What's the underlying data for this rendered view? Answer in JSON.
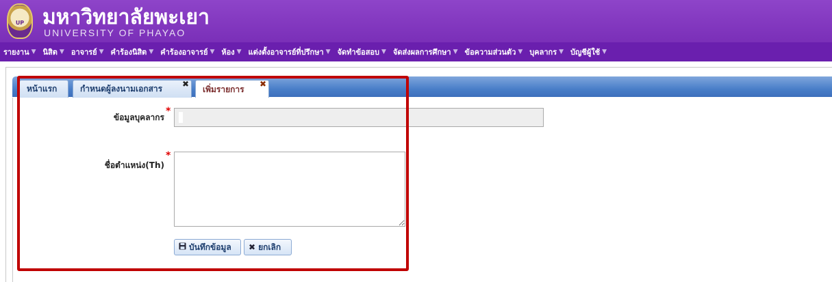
{
  "header": {
    "brand_th": "มหาวิทยาลัยพะเยา",
    "brand_en": "UNIVERSITY OF PHAYAO",
    "logo_text": "UP",
    "colors": {
      "header_bg": "#8e44c9",
      "nav_bg": "#6a1fae"
    }
  },
  "nav": {
    "items": [
      {
        "label": "รายงาน"
      },
      {
        "label": "นิสิต"
      },
      {
        "label": "อาจารย์"
      },
      {
        "label": "คำร้องนิสิต"
      },
      {
        "label": "คำร้องอาจารย์"
      },
      {
        "label": "ห้อง"
      },
      {
        "label": "แต่งตั้งอาจารย์ที่ปรึกษา"
      },
      {
        "label": "จัดทำข้อสอบ"
      },
      {
        "label": "จัดส่งผลการศึกษา"
      },
      {
        "label": "ข้อความส่วนตัว"
      },
      {
        "label": "บุคลากร"
      },
      {
        "label": "บัญชีผู้ใช้"
      }
    ],
    "caret": "▼"
  },
  "tabs": [
    {
      "label": "หน้าแรก",
      "closable": false
    },
    {
      "label": "กำหนดผู้ลงนามเอกสาร",
      "closable": true
    },
    {
      "label": "เพิ่มรายการ",
      "closable": true,
      "active": true
    }
  ],
  "close_glyph": "✖",
  "form": {
    "personnel_label": "ข้อมูลบุคลากร",
    "personnel_value": "",
    "title_label": "ชื่อตำแหน่ง(Th)",
    "title_value": "",
    "required_mark": "*",
    "save_label": "บันทึกข้อมูล",
    "cancel_label": "ยกเลิก",
    "save_icon": "floppy-icon",
    "cancel_icon": "x-icon"
  },
  "colors": {
    "highlight": "#c00000",
    "required": "#e00000",
    "tab_bar": "#4a7fc9"
  }
}
